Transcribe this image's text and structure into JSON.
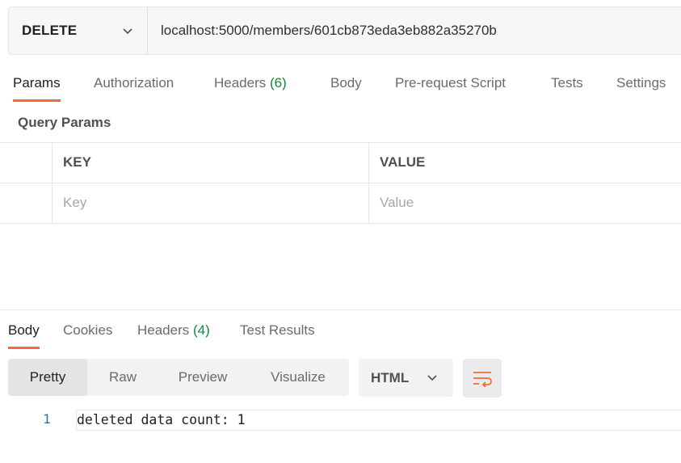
{
  "request": {
    "method": "DELETE",
    "url": "localhost:5000/members/601cb873eda3eb882a35270b"
  },
  "request_tabs": [
    {
      "label": "Params",
      "active": true
    },
    {
      "label": "Authorization"
    },
    {
      "label": "Headers",
      "count": "(6)"
    },
    {
      "label": "Body"
    },
    {
      "label": "Pre-request Script"
    },
    {
      "label": "Tests"
    },
    {
      "label": "Settings"
    }
  ],
  "query_params": {
    "title": "Query Params",
    "columns": [
      "KEY",
      "VALUE"
    ],
    "placeholders": {
      "key": "Key",
      "value": "Value"
    }
  },
  "response_tabs": [
    {
      "label": "Body",
      "active": true
    },
    {
      "label": "Cookies"
    },
    {
      "label": "Headers",
      "count": "(4)"
    },
    {
      "label": "Test Results"
    }
  ],
  "view_modes": [
    "Pretty",
    "Raw",
    "Preview",
    "Visualize"
  ],
  "active_view": "Pretty",
  "format": "HTML",
  "wrap_icon": "wrap-lines-icon",
  "response_body": {
    "line_number": "1",
    "text": "deleted data count: 1"
  },
  "colors": {
    "accent": "#f26b3a",
    "count_green": "#0f8a3c",
    "line_number_blue": "#2f6fa5"
  }
}
